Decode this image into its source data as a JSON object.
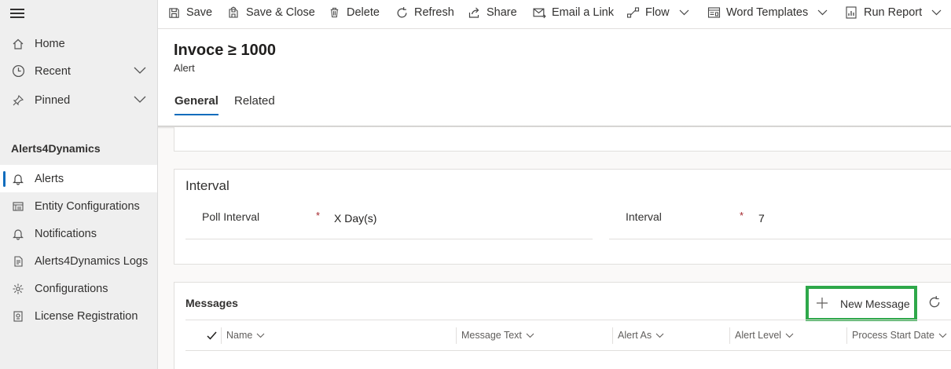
{
  "sidebar": {
    "items": [
      {
        "label": "Home",
        "icon": "home-icon"
      },
      {
        "label": "Recent",
        "icon": "clock-icon"
      },
      {
        "label": "Pinned",
        "icon": "pin-icon"
      }
    ],
    "group_title": "Alerts4Dynamics",
    "group_items": [
      {
        "label": "Alerts",
        "icon": "bell-icon",
        "selected": true
      },
      {
        "label": "Entity Configurations",
        "icon": "entity-config-icon"
      },
      {
        "label": "Notifications",
        "icon": "bell-icon"
      },
      {
        "label": "Alerts4Dynamics Logs",
        "icon": "log-icon"
      },
      {
        "label": "Configurations",
        "icon": "gear-icon"
      },
      {
        "label": "License Registration",
        "icon": "license-icon"
      }
    ]
  },
  "toolbar": {
    "save": "Save",
    "save_close": "Save & Close",
    "delete": "Delete",
    "refresh": "Refresh",
    "share": "Share",
    "email_link": "Email a Link",
    "flow": "Flow",
    "word_templates": "Word Templates",
    "run_report": "Run Report"
  },
  "record": {
    "title": "Invoce ≥ 1000",
    "entity": "Alert"
  },
  "tabs": [
    {
      "label": "General",
      "active": true
    },
    {
      "label": "Related",
      "active": false
    }
  ],
  "interval_section": {
    "title": "Interval",
    "poll_interval_label": "Poll Interval",
    "poll_interval_value": "X Day(s)",
    "interval_label": "Interval",
    "interval_value": "7",
    "required_marker": "*"
  },
  "messages_section": {
    "title": "Messages",
    "new_message_label": "New Message",
    "columns": [
      "Name",
      "Message Text",
      "Alert As",
      "Alert Level",
      "Process Start Date"
    ]
  },
  "colors": {
    "accent": "#0f6cbd",
    "highlight_box": "#2ea84a",
    "required": "#a4262c"
  }
}
